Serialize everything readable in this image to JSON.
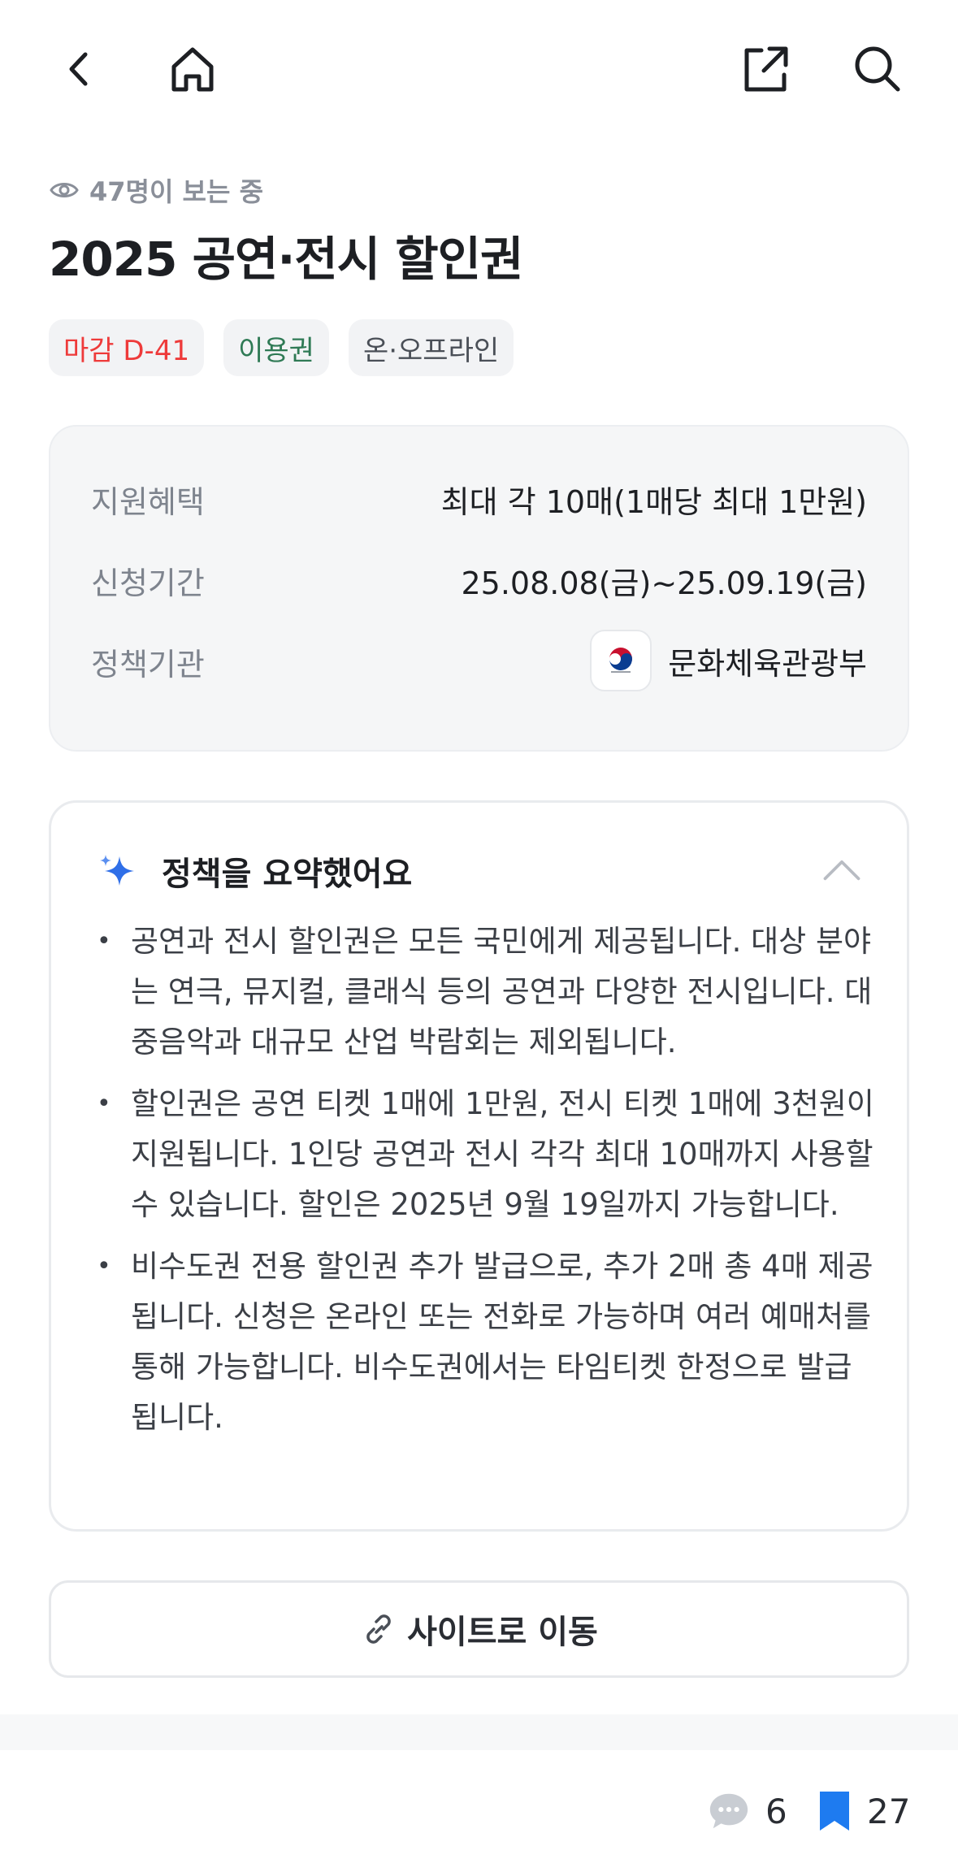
{
  "nav": {
    "back_icon": "chevron-left-icon",
    "home_icon": "home-icon",
    "share_icon": "share-icon",
    "search_icon": "search-icon"
  },
  "header": {
    "viewers": "47명이 보는 중",
    "title": "2025 공연·전시 할인권",
    "chips": [
      "마감 D-41",
      "이용권",
      "온·오프라인"
    ]
  },
  "info": {
    "benefit_label": "지원혜택",
    "benefit_value": "최대 각 10매(1매당 최대 1만원)",
    "period_label": "신청기간",
    "period_value": "25.08.08(금)~25.09.19(금)",
    "agency_label": "정책기관",
    "agency_value": "문화체육관광부"
  },
  "summary": {
    "title": "정책을 요약했어요",
    "items": [
      "공연과 전시 할인권은 모든 국민에게 제공됩니다. 대상 분야는 연극, 뮤지컬, 클래식 등의 공연과 다양한 전시입니다. 대중음악과 대규모 산업 박람회는 제외됩니다.",
      "할인권은 공연 티켓 1매에 1만원, 전시 티켓 1매에 3천원이 지원됩니다. 1인당 공연과 전시 각각 최대 10매까지 사용할 수 있습니다. 할인은 2025년 9월 19일까지 가능합니다.",
      "비수도권 전용 할인권 추가 발급으로, 추가 2매 총 4매 제공됩니다. 신청은 온라인 또는 전화로 가능하며 여러 예매처를 통해 가능합니다. 비수도권에서는 타임티켓 한정으로 발급됩니다."
    ]
  },
  "site_button": "사이트로 이동",
  "bottom": {
    "comment_count": "6",
    "bookmark_count": "27"
  },
  "colors": {
    "deadline": "#ee3a3a",
    "usage": "#2f7a55",
    "bookmark": "#1e7bf0"
  }
}
